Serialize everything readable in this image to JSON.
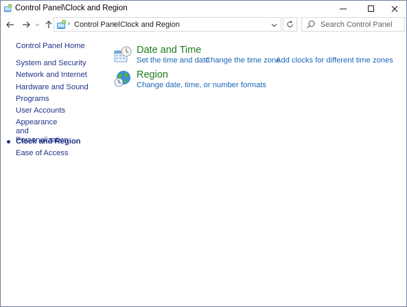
{
  "window": {
    "title": "Control Panel\\Clock and Region"
  },
  "nav": {
    "breadcrumb": [
      "Control Panel",
      "Clock and Region"
    ],
    "search_placeholder": "Search Control Panel"
  },
  "sidebar": {
    "items": [
      {
        "label": "Control Panel Home"
      },
      {
        "label": "System and Security"
      },
      {
        "label": "Network and Internet"
      },
      {
        "label": "Hardware and Sound"
      },
      {
        "label": "Programs"
      },
      {
        "label": "User Accounts"
      },
      {
        "label": "Appearance and Personalization"
      },
      {
        "label": "Clock and Region",
        "current": true
      },
      {
        "label": "Ease of Access"
      }
    ]
  },
  "categories": [
    {
      "title": "Date and Time",
      "icon": "date-time-icon",
      "links": [
        "Set the time and date",
        "Change the time zone",
        "Add clocks for different time zones"
      ]
    },
    {
      "title": "Region",
      "icon": "globe-icon",
      "links": [
        "Change date, time, or number formats"
      ]
    }
  ],
  "colors": {
    "category_title": "#1c7a1c",
    "link": "#1a66b8",
    "sidebar_link": "#1e3287"
  }
}
